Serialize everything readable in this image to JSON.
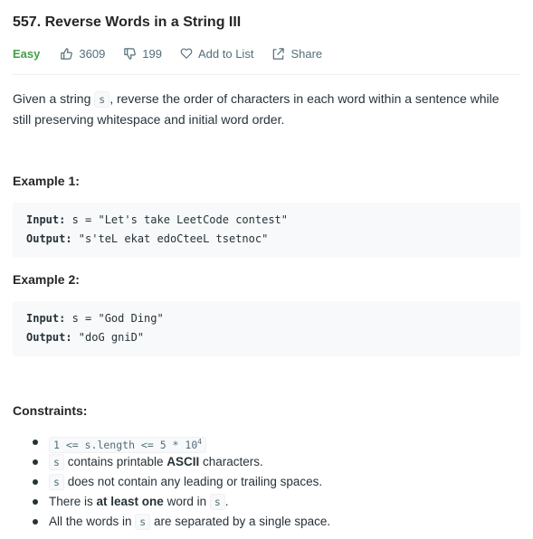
{
  "problem": {
    "title": "557. Reverse Words in a String III",
    "difficulty": "Easy",
    "likes": "3609",
    "dislikes": "199",
    "add_to_list": "Add to List",
    "share": "Share",
    "accent_easy": "#43a047"
  },
  "description": {
    "part1": "Given a string ",
    "code_s": "s",
    "part2": ", reverse the order of characters in each word within a sentence while still preserving whitespace and initial word order."
  },
  "example1": {
    "heading": "Example 1:",
    "input_label": "Input:",
    "input_value": " s = \"Let's take LeetCode contest\"",
    "output_label": "Output:",
    "output_value": " \"s'teL ekat edoCteeL tsetnoc\""
  },
  "example2": {
    "heading": "Example 2:",
    "input_label": "Input:",
    "input_value": " s = \"God Ding\"",
    "output_label": "Output:",
    "output_value": " \"doG gniD\""
  },
  "constraints": {
    "heading": "Constraints:",
    "c1_code": "1 <= s.length <= 5 * 10",
    "c1_sup": "4",
    "c2_code": "s",
    "c2_text1": " contains printable ",
    "c2_bold": "ASCII",
    "c2_text2": " characters.",
    "c3_code": "s",
    "c3_text": " does not contain any leading or trailing spaces.",
    "c4_text1": "There is ",
    "c4_bold": "at least one",
    "c4_text2": " word in ",
    "c4_code": "s",
    "c4_text3": ".",
    "c5_text1": "All the words in ",
    "c5_code": "s",
    "c5_text2": " are separated by a single space."
  }
}
